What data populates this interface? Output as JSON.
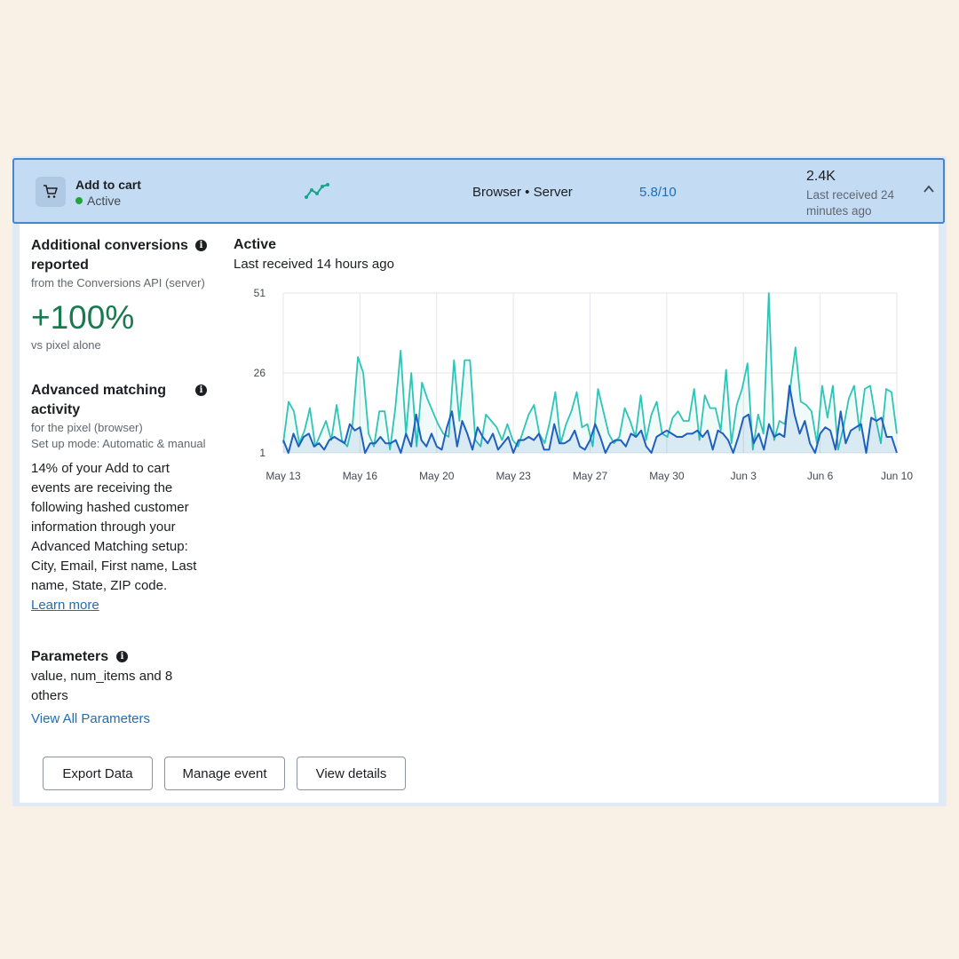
{
  "event": {
    "name": "Add to cart",
    "status": "Active",
    "sources": "Browser • Server",
    "score": "5.8/10",
    "count": "2.4K",
    "last_received": "Last received 24 minutes ago"
  },
  "icons": {
    "cart": "shopping-cart-icon",
    "trend": "trend-line-icon",
    "collapse": "chevron-up-icon",
    "info": "info-icon"
  },
  "colors": {
    "accent": "#1f6db3",
    "success": "#1a7a4f",
    "server_line": "#2ec4b6",
    "browser_line": "#1f5fbf",
    "header_bg": "#c3dbf3"
  },
  "left": {
    "conversions": {
      "title": "Additional conversions reported",
      "source": "from the Conversions API (server)",
      "value": "+100%",
      "comparison": "vs pixel alone"
    },
    "matching": {
      "title": "Advanced matching activity",
      "source": "for the pixel (browser)",
      "mode": "Set up mode: Automatic & manual",
      "description": "14% of your Add to cart events are receiving the following hashed customer information through your Advanced Matching setup: City, Email, First name, Last name, State, ZIP code.",
      "learn_more": "Learn more"
    },
    "parameters": {
      "title": "Parameters",
      "list": "value, num_items and 8 others",
      "view_all": "View All Parameters"
    }
  },
  "chart": {
    "title": "Active",
    "subtitle": "Last received 14 hours ago"
  },
  "buttons": {
    "export": "Export Data",
    "manage": "Manage event",
    "details": "View details"
  },
  "chart_data": {
    "type": "line",
    "title": "",
    "xlabel": "",
    "ylabel": "",
    "ylim": [
      1,
      51
    ],
    "yticks": [
      1,
      26,
      51
    ],
    "xlim": [
      0,
      112
    ],
    "xtick_positions": [
      0,
      14,
      28,
      42,
      56,
      70,
      84,
      98,
      112
    ],
    "xtick_labels": [
      "May 13",
      "May 16",
      "May 20",
      "May 23",
      "May 27",
      "May 30",
      "Jun 3",
      "Jun 6",
      "Jun 10"
    ],
    "grid": true,
    "series": [
      {
        "color": "#2ec4b6",
        "values": [
          4,
          17,
          14,
          4,
          8,
          15,
          3,
          7,
          11,
          5,
          16,
          5,
          3,
          10,
          31,
          26,
          7,
          3,
          14,
          14,
          2,
          15,
          33,
          7,
          26,
          3,
          23,
          18,
          14,
          10,
          7,
          6,
          30,
          11,
          30,
          30,
          5,
          3,
          13,
          11,
          9,
          5,
          10,
          5,
          3,
          8,
          13,
          16,
          7,
          4,
          11,
          20,
          4,
          10,
          14,
          20,
          9,
          10,
          3,
          21,
          14,
          7,
          4,
          6,
          15,
          11,
          6,
          19,
          5,
          13,
          17,
          7,
          6,
          12,
          14,
          11,
          11,
          21,
          5,
          19,
          15,
          15,
          8,
          27,
          4,
          16,
          21,
          29,
          2,
          13,
          7,
          51,
          5,
          11,
          10,
          21,
          34,
          17,
          16,
          14,
          4,
          22,
          12,
          22,
          2,
          9,
          18,
          22,
          8,
          21,
          22,
          12,
          4,
          21,
          20,
          7
        ],
        "name": ""
      },
      {
        "color": "#1f5fbf",
        "values": [
          5,
          1,
          7,
          3,
          6,
          7,
          3,
          4,
          2,
          5,
          6,
          5,
          4,
          10,
          8,
          9,
          1,
          4,
          4,
          6,
          4,
          4,
          5,
          1,
          7,
          3,
          13,
          5,
          3,
          7,
          3,
          2,
          9,
          14,
          3,
          11,
          7,
          2,
          9,
          6,
          4,
          7,
          2,
          4,
          6,
          1,
          5,
          5,
          6,
          5,
          7,
          2,
          2,
          10,
          4,
          4,
          5,
          8,
          3,
          2,
          5,
          10,
          6,
          1,
          4,
          5,
          5,
          3,
          7,
          6,
          8,
          3,
          1,
          6,
          7,
          8,
          7,
          6,
          6,
          7,
          7,
          8,
          6,
          8,
          2,
          8,
          7,
          5,
          1,
          6,
          12,
          13,
          4,
          7,
          2,
          10,
          6,
          7,
          6,
          22,
          13,
          7,
          11,
          4,
          1,
          7,
          9,
          8,
          2,
          14,
          4,
          8,
          9,
          10,
          1,
          12,
          11,
          12,
          6,
          6,
          1
        ]
      }
    ]
  }
}
